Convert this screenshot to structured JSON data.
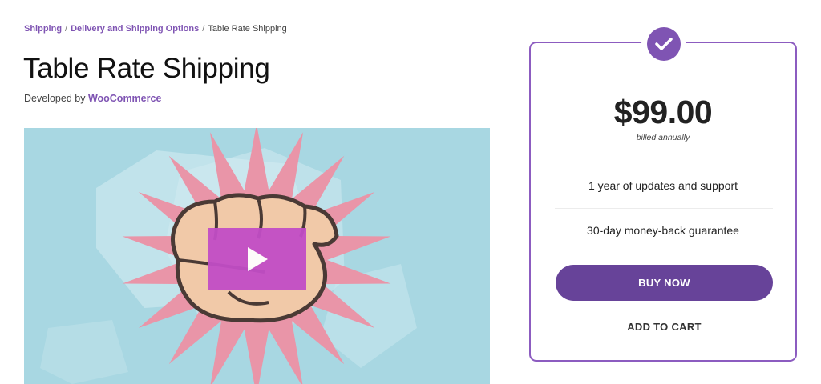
{
  "breadcrumb": {
    "items": [
      "Shipping",
      "Delivery and Shipping Options"
    ],
    "separator": "/",
    "current": "Table Rate Shipping"
  },
  "product": {
    "title": "Table Rate Shipping",
    "developed_by_prefix": "Developed by",
    "developer": "WooCommerce"
  },
  "video": {
    "play_icon": "play-icon",
    "background_color": "#a8d7e2",
    "play_color": "#c24dc6"
  },
  "pricing": {
    "badge_icon": "checkmark-icon",
    "price": "$99.00",
    "billing_note": "billed annually",
    "features": [
      "1 year of updates and support",
      "30-day money-back guarantee"
    ],
    "buy_label": "BUY NOW",
    "add_to_cart_label": "ADD TO CART",
    "accent_color": "#7f54b3",
    "button_color": "#674399"
  }
}
